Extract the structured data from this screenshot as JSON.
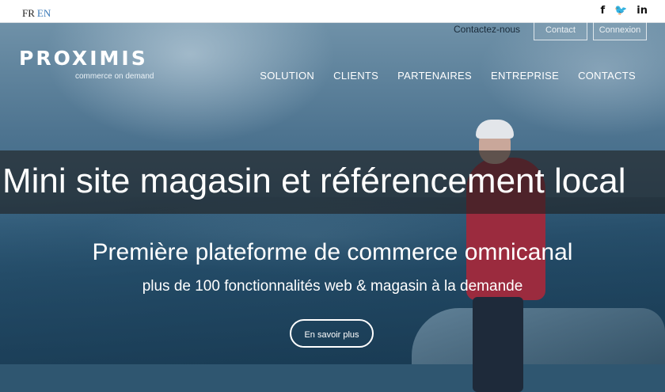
{
  "topbar": {
    "languages": [
      "FR",
      "EN"
    ],
    "social": [
      "f",
      "🐦",
      "in"
    ]
  },
  "header": {
    "contact_link": "Contactez-nous",
    "button_1": "Contact",
    "button_2": "Connexion",
    "logo_text": "PROXIMIS",
    "logo_tagline": "commerce on demand"
  },
  "nav": {
    "items": [
      "SOLUTION",
      "CLIENTS",
      "PARTENAIRES",
      "ENTREPRISE",
      "CONTACTS"
    ]
  },
  "band": {
    "title": "Mini site magasin et référencement local"
  },
  "hero": {
    "headline": "Première plateforme de commerce omnicanal",
    "subheadline": "plus de 100 fonctionnalités web & magasin à la demande",
    "cta": "En savoir plus"
  }
}
